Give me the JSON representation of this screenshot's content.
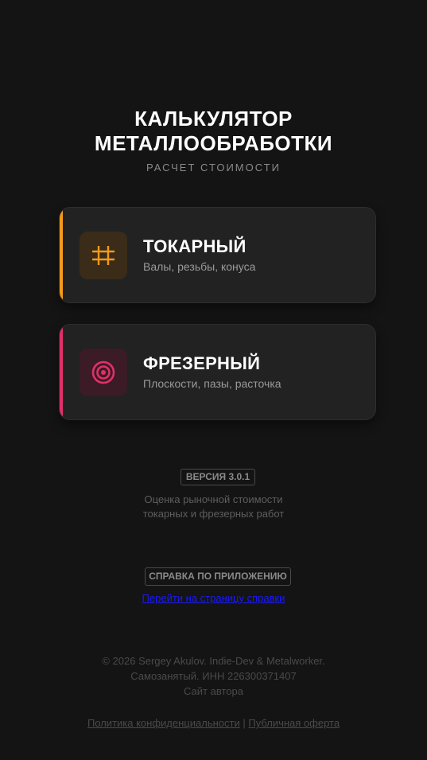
{
  "header": {
    "title_line1": "КАЛЬКУЛЯТОР",
    "title_line2": "МЕТАЛЛООБРАБОТКИ",
    "subtitle": "РАСЧЕТ СТОИМОСТИ"
  },
  "cards": [
    {
      "title": "ТОКАРНЫЙ",
      "description": "Валы, резьбы, конуса",
      "icon": "lathe-icon",
      "accent_color": "#f29a1b"
    },
    {
      "title": "ФРЕЗЕРНЫЙ",
      "description": "Плоскости, пазы, расточка",
      "icon": "milling-target-icon",
      "accent_color": "#e0306a"
    }
  ],
  "version": {
    "badge": "ВЕРСИЯ 3.0.1",
    "desc_line1": "Оценка рыночной стоимости",
    "desc_line2": "токарных и фрезерных работ"
  },
  "help": {
    "badge": "СПРАВКА ПО ПРИЛОЖЕНИЮ",
    "link_text": "Перейти на страницу справки"
  },
  "footer": {
    "copyright": "© 2026 Sergey Akulov. Indie-Dev & Metalworker.",
    "tax_status": "Самозанятый. ИНН 226300371407",
    "author_site": "Сайт автора"
  },
  "legal": {
    "privacy": "Политика конфиденциальности",
    "separator": "|",
    "offer": "Публичная оферта"
  }
}
